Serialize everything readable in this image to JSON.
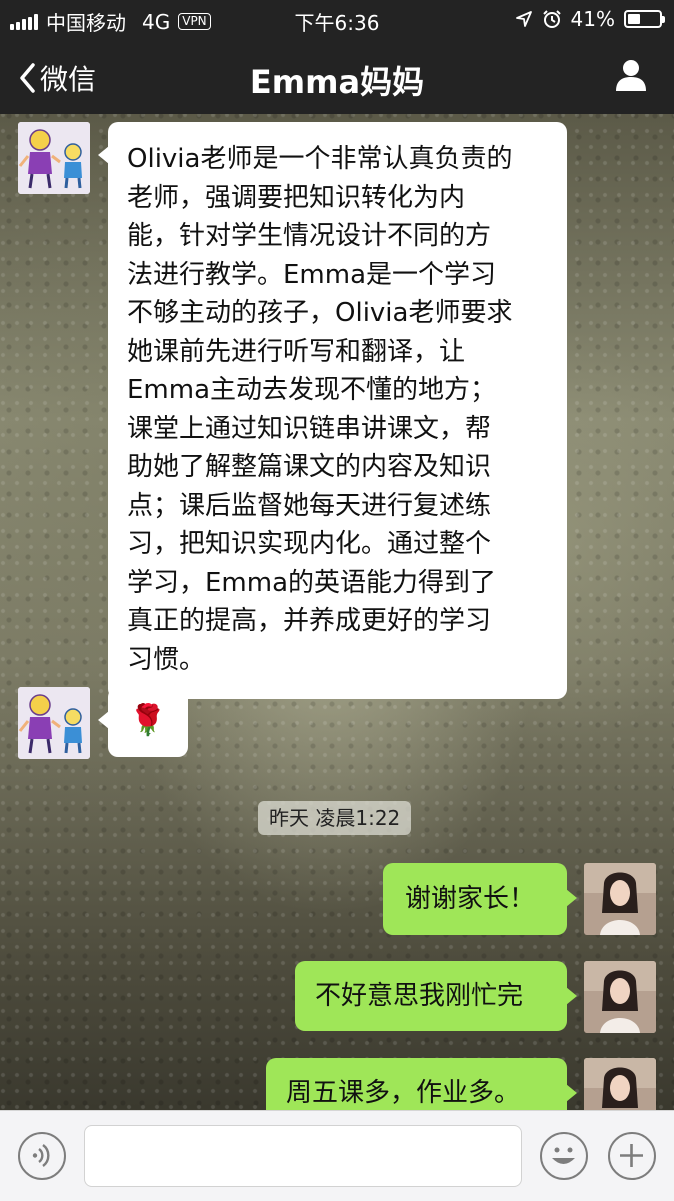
{
  "status_bar": {
    "carrier": "中国移动",
    "network": "4G",
    "vpn": "VPN",
    "time": "下午6:36",
    "battery_percent": "41%",
    "battery_level": 0.41
  },
  "nav": {
    "back_label": "微信",
    "title": "Emma妈妈"
  },
  "messages": [
    {
      "direction": "incoming",
      "text": "Olivia老师是一个非常认真负责的\n老师，强调要把知识转化为内\n能，针对学生情况设计不同的方\n法进行教学。Emma是一个学习\n不够主动的孩子，Olivia老师要求\n她课前先进行听写和翻译，让\nEmma主动去发现不懂的地方；\n课堂上通过知识链串讲课文，帮\n助她了解整篇课文的内容及知识\n点；课后监督她每天进行复述练\n习，把知识实现内化。通过整个\n学习，Emma的英语能力得到了\n真正的提高，并养成更好的学习\n习惯。"
    },
    {
      "direction": "incoming",
      "emoji": "🌹"
    },
    {
      "direction": "outgoing",
      "text": "谢谢家长！"
    },
    {
      "direction": "outgoing",
      "text": "不好意思我刚忙完"
    },
    {
      "direction": "outgoing",
      "text": "周五课多，作业多。"
    }
  ],
  "timestamp": "昨天 凌晨1:22",
  "icons": {
    "back": "chevron-left-icon",
    "profile": "person-icon",
    "voice": "voice-icon",
    "emoji": "emoji-icon",
    "add": "plus-icon"
  },
  "colors": {
    "bar_background": "#232323",
    "incoming_bubble": "#ffffff",
    "outgoing_bubble": "#9fe658",
    "input_bar": "#f4f4f6"
  }
}
